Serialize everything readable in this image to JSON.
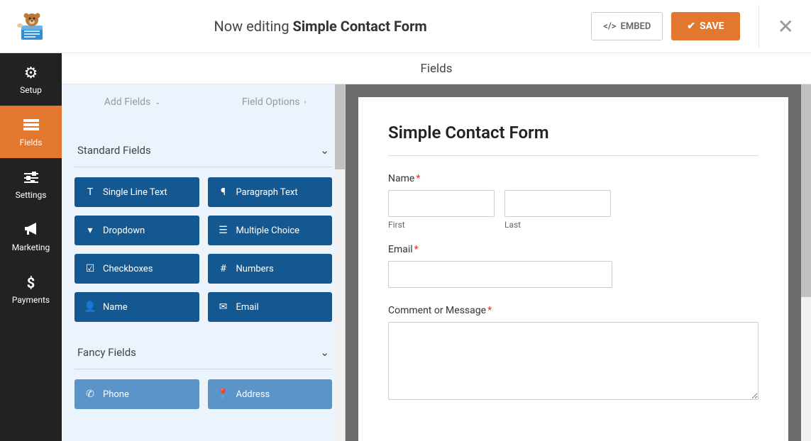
{
  "header": {
    "editing_prefix": "Now editing",
    "form_name": "Simple Contact Form",
    "embed_label": "EMBED",
    "save_label": "SAVE"
  },
  "sidenav": [
    {
      "label": "Setup",
      "active": false
    },
    {
      "label": "Fields",
      "active": true
    },
    {
      "label": "Settings",
      "active": false
    },
    {
      "label": "Marketing",
      "active": false
    },
    {
      "label": "Payments",
      "active": false
    }
  ],
  "panel_title": "Fields",
  "left_tabs": {
    "add_fields": "Add Fields",
    "field_options": "Field Options"
  },
  "sections": {
    "standard": {
      "title": "Standard Fields",
      "fields": [
        "Single Line Text",
        "Paragraph Text",
        "Dropdown",
        "Multiple Choice",
        "Checkboxes",
        "Numbers",
        "Name",
        "Email"
      ]
    },
    "fancy": {
      "title": "Fancy Fields",
      "fields": [
        "Phone",
        "Address"
      ]
    }
  },
  "form": {
    "title": "Simple Contact Form",
    "name_label": "Name",
    "first_sub": "First",
    "last_sub": "Last",
    "email_label": "Email",
    "comment_label": "Comment or Message"
  },
  "colors": {
    "accent": "#e27730",
    "field_btn": "#145892",
    "fancy_btn": "#5a94c8"
  }
}
